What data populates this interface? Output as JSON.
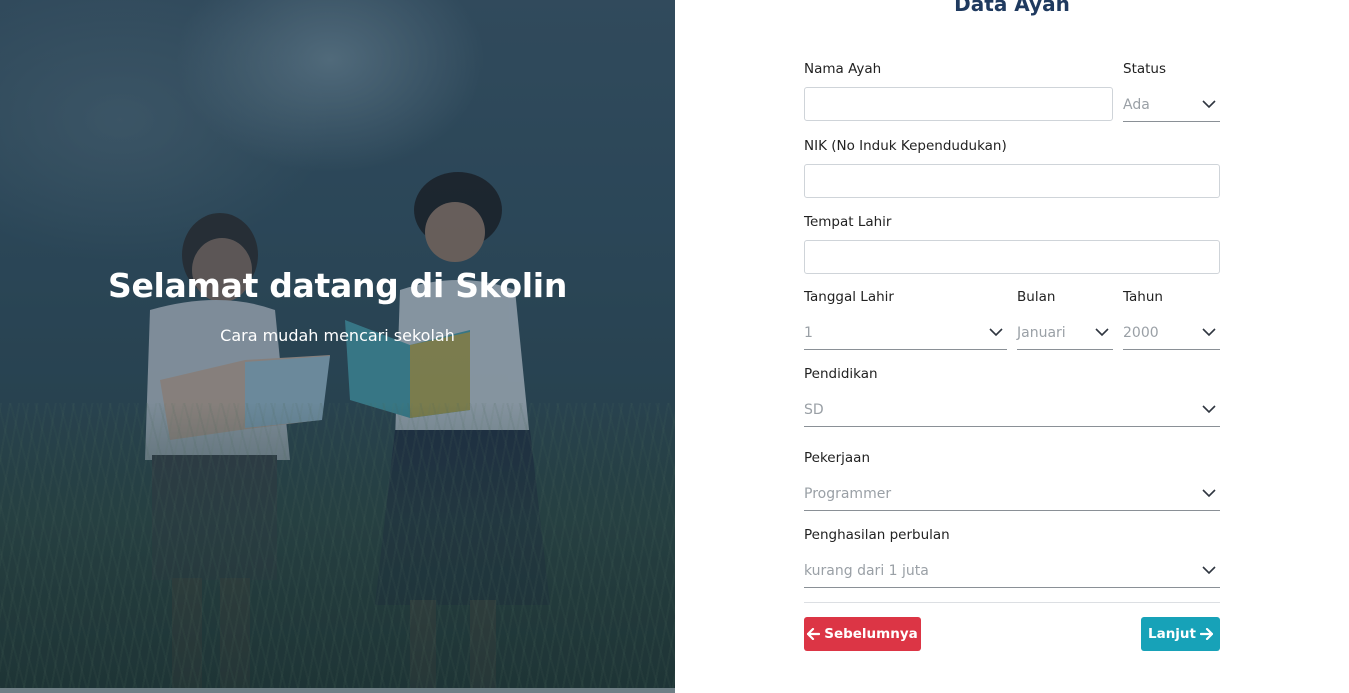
{
  "hero": {
    "title": "Selamat datang di Skolin",
    "subtitle": "Cara mudah mencari sekolah"
  },
  "form": {
    "title": "Data Ayah",
    "nama_ayah": {
      "label": "Nama Ayah",
      "value": ""
    },
    "status": {
      "label": "Status",
      "value": "Ada"
    },
    "nik": {
      "label": "NIK (No Induk Kependudukan)",
      "value": ""
    },
    "tempat_lahir": {
      "label": "Tempat Lahir",
      "value": ""
    },
    "tanggal_lahir": {
      "label": "Tanggal Lahir",
      "value": "1"
    },
    "bulan": {
      "label": "Bulan",
      "value": "Januari"
    },
    "tahun": {
      "label": "Tahun",
      "value": "2000"
    },
    "pendidikan": {
      "label": "Pendidikan",
      "value": "SD"
    },
    "pekerjaan": {
      "label": "Pekerjaan",
      "value": "Programmer"
    },
    "penghasilan": {
      "label": "Penghasilan perbulan",
      "value": "kurang dari 1 juta"
    }
  },
  "buttons": {
    "prev": {
      "label": "Sebelumnya",
      "icon": "arrow-left-icon"
    },
    "next": {
      "label": "Lanjut",
      "icon": "arrow-right-icon"
    }
  },
  "colors": {
    "title": "#1f3a5f",
    "prev_button": "#dc3545",
    "next_button": "#17a2b8"
  }
}
